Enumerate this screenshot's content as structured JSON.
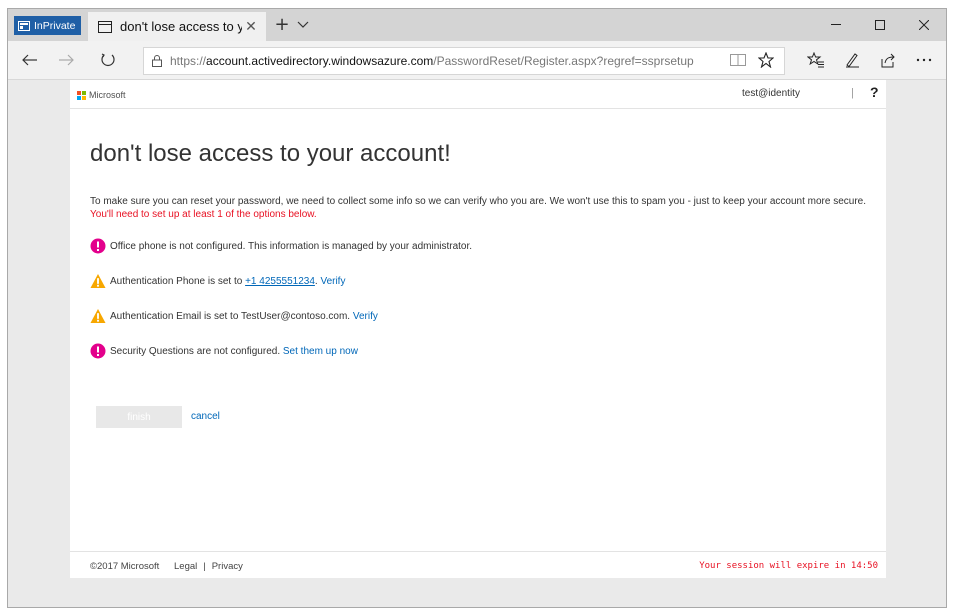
{
  "browser": {
    "inprivate_label": "InPrivate",
    "tab_title": "don't lose access to you",
    "url": {
      "scheme": "https://",
      "host": "account.activedirectory.windowsazure.com",
      "path": "/PasswordReset/Register.aspx?regref=ssprsetup"
    }
  },
  "header": {
    "brand": "Microsoft",
    "user": "test@identity",
    "separator": "|",
    "help": "?"
  },
  "main": {
    "title": "don't lose access to your account!",
    "intro_text": "To make sure you can reset your password, we need to collect some info so we can verify who you are. We won't use this to spam you - just to keep your account more secure.",
    "intro_required": "You'll need to set up at least 1 of the options below.",
    "items": [
      {
        "text": "Office phone is not configured. This information is managed by your administrator.",
        "status": "error"
      },
      {
        "text": "Authentication Phone is set to",
        "value": "+1 4255551234",
        "link": "Verify",
        "status": "warning"
      },
      {
        "text": "Authentication Email is set to TestUser@contoso.com.",
        "link": "Verify",
        "status": "warning"
      },
      {
        "text": "Security Questions are not configured.",
        "link": "Set them up now",
        "status": "error"
      }
    ],
    "finish_label": "finish",
    "cancel_label": "cancel"
  },
  "footer": {
    "copyright": "©2017 Microsoft",
    "legal": "Legal",
    "divider": "|",
    "privacy": "Privacy",
    "session": "Your session will expire in 14:50"
  },
  "colors": {
    "error": "#e3008c",
    "warning": "#f7a700",
    "link": "#0067b8",
    "alert_text": "#e81123",
    "inprivate": "#1f5fa6"
  }
}
